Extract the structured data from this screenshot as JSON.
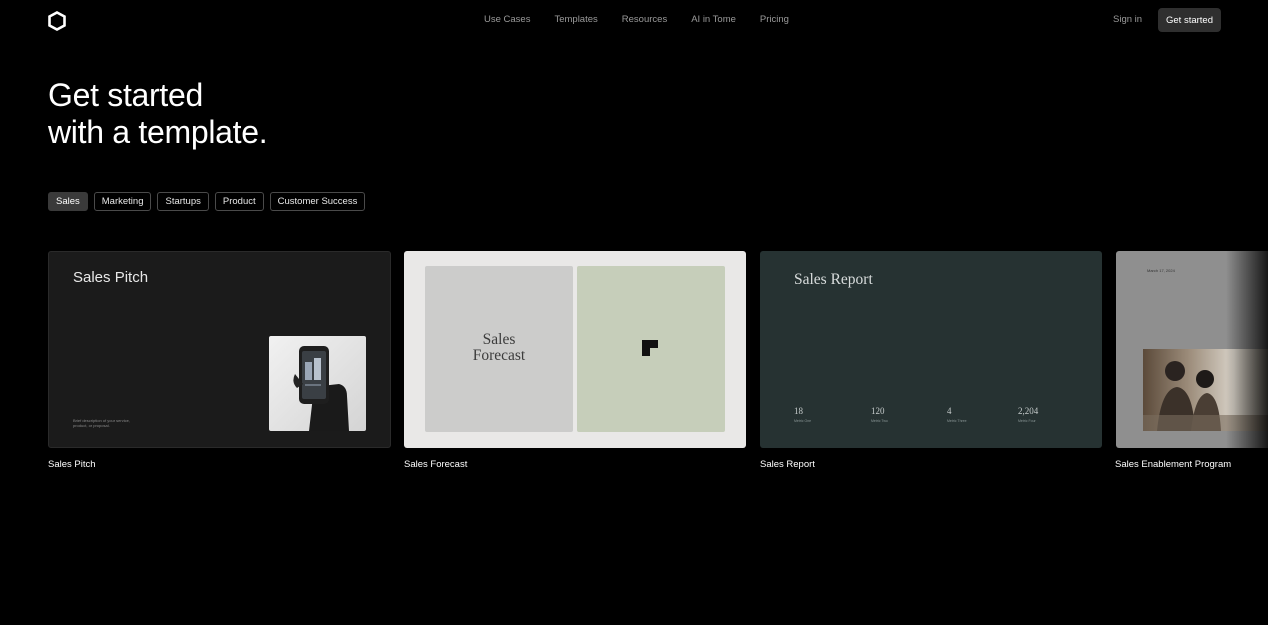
{
  "nav": {
    "links": [
      "Use Cases",
      "Templates",
      "Resources",
      "AI in Tome",
      "Pricing"
    ],
    "sign_in": "Sign in",
    "get_started": "Get started"
  },
  "hero": {
    "line1": "Get started",
    "line2": "with a template."
  },
  "filters": [
    "Sales",
    "Marketing",
    "Startups",
    "Product",
    "Customer Success"
  ],
  "active_filter": "Sales",
  "cards": [
    {
      "caption": "Sales Pitch",
      "preview_title": "Sales Pitch",
      "preview_desc": "Brief description of your service, product, or proposal."
    },
    {
      "caption": "Sales Forecast",
      "preview_title_line1": "Sales",
      "preview_title_line2": "Forecast"
    },
    {
      "caption": "Sales Report",
      "preview_title": "Sales Report",
      "stats": [
        {
          "value": "18",
          "label": "Metric One"
        },
        {
          "value": "120",
          "label": "Metric Two"
        },
        {
          "value": "4",
          "label": "Metric Three"
        },
        {
          "value": "2,204",
          "label": "Metric Four"
        }
      ]
    },
    {
      "caption": "Sales Enablement Program",
      "preview_date": "March 17, 2024"
    }
  ],
  "colors": {
    "background": "#000000",
    "nav_text": "#9a9a9a",
    "button_bg": "#2f2f2f",
    "chip_active_bg": "#3a3a3a",
    "card_report_bg": "#263232",
    "card_forecast_green": "#c6ceba"
  },
  "icons": [
    "tome-logo-icon",
    "phone-photo",
    "forecast-logo-icon",
    "meeting-photo"
  ]
}
